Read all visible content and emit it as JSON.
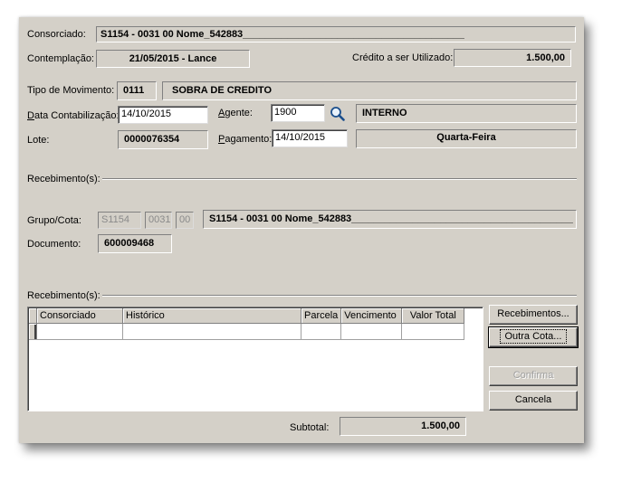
{
  "header": {
    "consorciado_label": "Consorciado:",
    "consorciado_value": "S1154  - 0031 00  Nome_542883________________________________________",
    "contemplacao_label": "Contemplação:",
    "contemplacao_value": "21/05/2015 - Lance",
    "credito_label": "Crédito a ser Utilizado:",
    "credito_value": "1.500,00"
  },
  "movimento": {
    "tipo_label": "Tipo de Movimento:",
    "tipo_code": "0111",
    "tipo_desc": "SOBRA DE CREDITO",
    "data_label_u": "D",
    "data_label_rest": "ata Contabilização:",
    "data_value": "14/10/2015",
    "agente_label_u": "A",
    "agente_label_rest": "gente:",
    "agente_value": "1900",
    "agente_desc": "INTERNO",
    "lote_label": "Lote:",
    "lote_value": "0000076354",
    "pagamento_label_u": "P",
    "pagamento_label_rest": "agamento:",
    "pagamento_value": "14/10/2015",
    "pagamento_desc": "Quarta-Feira"
  },
  "recebimentos_section": {
    "label": "Recebimento(s):",
    "grupo_label": "Grupo/Cota:",
    "grupo": "S1154",
    "cota": "0031",
    "digito": "00",
    "grupo_desc": "S1154  - 0031 00  Nome_542883________________________________________",
    "documento_label": "Documento:",
    "documento_value": "600009468"
  },
  "grid_section": {
    "label": "Recebimento(s):",
    "columns": [
      "Consorciado",
      "Histórico",
      "Parcela",
      "Vencimento",
      "Valor Total"
    ],
    "rows": [
      [
        "",
        "",
        "",
        "",
        ""
      ]
    ],
    "subtotal_label": "Subtotal:",
    "subtotal_value": "1.500,00"
  },
  "buttons": {
    "recebimentos": "Recebimentos...",
    "outra_cota": "Outra Cota...",
    "confirma": "Confirma",
    "cancela": "Cancela"
  },
  "icons": {
    "search": "magnifier-icon"
  }
}
